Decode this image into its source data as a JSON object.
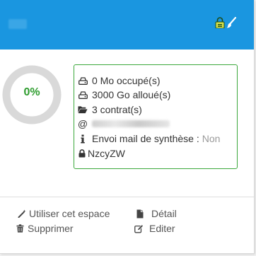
{
  "header": {
    "title": "",
    "colors": {
      "background": "#1a96e0",
      "icon_lock": "#d7e04a",
      "icon_brush": "#ffffff"
    }
  },
  "usage": {
    "percent_label": "0%",
    "percent": 0,
    "ring_color": "#d9d9d9",
    "label_color": "#2e9c2e"
  },
  "info": {
    "used": "0 Mo occupé(s)",
    "allocated": "3000 Go alloué(s)",
    "contracts": "3 contrat(s)",
    "email_prefix": "@",
    "email_value": "",
    "mail_summary_label": "Envoi mail de synthèse :",
    "mail_summary_value": "Non",
    "code": "NzcyZW",
    "border_color": "#3ca83c"
  },
  "actions": {
    "use_space": "Utiliser cet espace",
    "delete": "Supprimer",
    "detail": "Détail",
    "edit": "Editer"
  }
}
